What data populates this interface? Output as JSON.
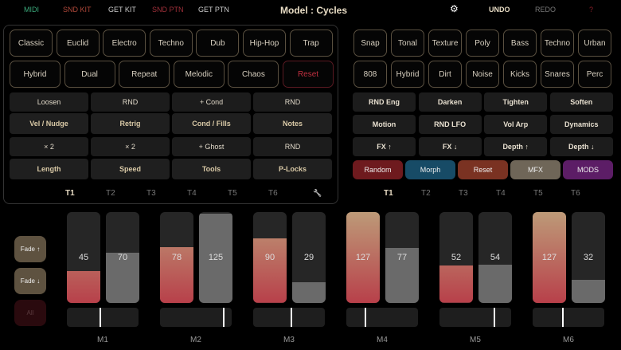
{
  "header": {
    "midi": "MIDI",
    "snd_kit": "SND KIT",
    "get_kit": "GET KIT",
    "snd_ptn": "SND PTN",
    "get_ptn": "GET PTN",
    "title": "Model : Cycles",
    "undo": "UNDO",
    "redo": "REDO",
    "help": "?",
    "settings_icon": "gear-icon"
  },
  "left": {
    "row1": [
      "Classic",
      "Euclid",
      "Electro",
      "Techno",
      "Dub",
      "Hip-Hop",
      "Trap"
    ],
    "row2": [
      "Hybrid",
      "Dual",
      "Repeat",
      "Melodic",
      "Chaos",
      "Reset"
    ],
    "grid_top": [
      "Loosen",
      "RND",
      "+ Cond",
      "RND"
    ],
    "grid_top_labels": [
      "Vel / Nudge",
      "Retrig",
      "Cond / Fills",
      "Notes"
    ],
    "grid_bottom": [
      "× 2",
      "× 2",
      "+ Ghost",
      "RND"
    ],
    "grid_bottom_labels": [
      "Length",
      "Speed",
      "Tools",
      "P-Locks"
    ],
    "tabs": [
      "T1",
      "T2",
      "T3",
      "T4",
      "T5",
      "T6"
    ],
    "active_tab": "T1"
  },
  "right": {
    "row1": [
      "Snap",
      "Tonal",
      "Texture",
      "Poly",
      "Bass",
      "Techno",
      "Urban"
    ],
    "row2": [
      "808",
      "Hybrid",
      "Dirt",
      "Noise",
      "Kicks",
      "Snares",
      "Perc"
    ],
    "grid": [
      [
        "RND Eng",
        "Darken",
        "Tighten",
        "Soften"
      ],
      [
        "Motion",
        "RND LFO",
        "Vol Arp",
        "Dynamics"
      ],
      [
        "FX ↑",
        "FX ↓",
        "Depth ↑",
        "Depth ↓"
      ]
    ],
    "colored": [
      {
        "label": "Random",
        "color": "#6e1a1e"
      },
      {
        "label": "Morph",
        "color": "#174b66"
      },
      {
        "label": "Reset",
        "color": "#7a3222"
      },
      {
        "label": "MFX",
        "color": "#6f6658"
      },
      {
        "label": "MODS",
        "color": "#5c1d66"
      }
    ],
    "tabs": [
      "T1",
      "T2",
      "T3",
      "T4",
      "T5",
      "T6"
    ],
    "active_tab": "T1"
  },
  "side": {
    "fade_up": "Fade ↑",
    "fade_down": "Fade ↓",
    "all": "All"
  },
  "modules": [
    {
      "label": "M1",
      "a": 45,
      "b": 70,
      "slider": 0.47
    },
    {
      "label": "M2",
      "a": 78,
      "b": 125,
      "slider": 0.9
    },
    {
      "label": "M3",
      "a": 90,
      "b": 29,
      "slider": 0.53
    },
    {
      "label": "M4",
      "a": 127,
      "b": 77,
      "slider": 0.26
    },
    {
      "label": "M5",
      "a": 52,
      "b": 54,
      "slider": 0.77
    },
    {
      "label": "M6",
      "a": 127,
      "b": 32,
      "slider": 0.42
    }
  ],
  "max": 127
}
